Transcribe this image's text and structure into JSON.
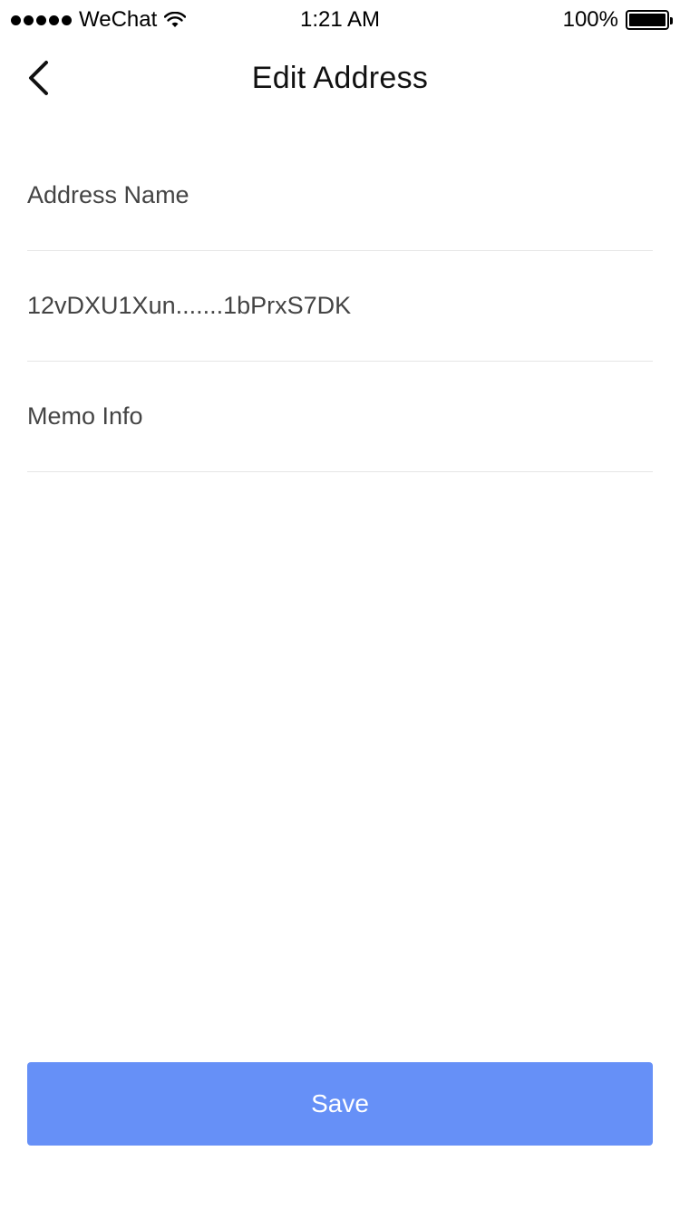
{
  "status_bar": {
    "carrier": "WeChat",
    "time": "1:21 AM",
    "battery": "100%"
  },
  "nav": {
    "title": "Edit Address",
    "back_icon": "chevron-left-icon"
  },
  "form": {
    "address_name_placeholder": "Address Name",
    "address_value": "12vDXU1Xun.......1bPrxS7DK",
    "memo_placeholder": "Memo Info"
  },
  "actions": {
    "save_label": "Save"
  },
  "colors": {
    "accent": "#6690f7",
    "divider": "#e6e6e6",
    "text": "#444444"
  }
}
